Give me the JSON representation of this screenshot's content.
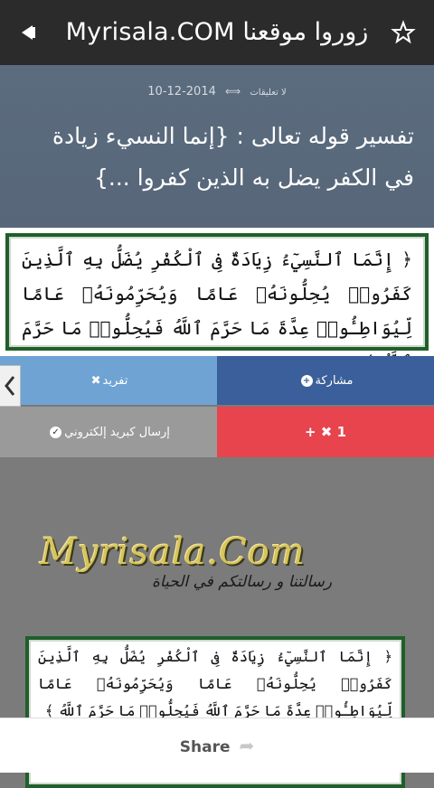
{
  "header": {
    "title": "Myrisala.COM زوروا موقعنا",
    "left_icon": "collapse-arrow-icon",
    "right_icon": "star-icon"
  },
  "post": {
    "date": "2014-12-10",
    "comments": "لا تعليقات",
    "title": "تفسير قوله تعالى : {إنما النسيء زيادة في الكفر يضل به الذين كفروا ...}"
  },
  "verse": {
    "text": "﴿ إِنَّمَا ٱلنَّسِيٓءُ زِيَادَةٌ فِى ٱلْكُفْرِ يُضَلُّ بِهِ ٱلَّذِينَ كَفَرُوا۟ يُحِلُّونَهُۥ عَامًا وَيُحَرِّمُونَهُۥ عَامًا لِّيُوَاطِـُٔوا۟ عِدَّةَ مَا حَرَّمَ ٱللَّهُ فَيُحِلُّوا۟ مَا حَرَّمَ ٱللَّهُ ﴾"
  },
  "actions": {
    "share": "مشاركة",
    "unsubscribe": "تفريد",
    "email": "إرسال كبريد إلكتروني",
    "plus_count": "+ ✖ 1"
  },
  "logo": {
    "main": "Myrisala.Com",
    "tagline": "رسالتنا و رسالتكم في الحياة"
  },
  "share_bar": {
    "label": "Share"
  },
  "colors": {
    "topbar": "#2b2b2b",
    "hero": "#5b6c7e",
    "share": "#3a5f9a",
    "unsubscribe": "#6fa3d3",
    "email": "#9a9a9a",
    "plus": "#e8444e",
    "verse_border": "#1f5f2a",
    "logo_gold": "#d8c45a"
  }
}
